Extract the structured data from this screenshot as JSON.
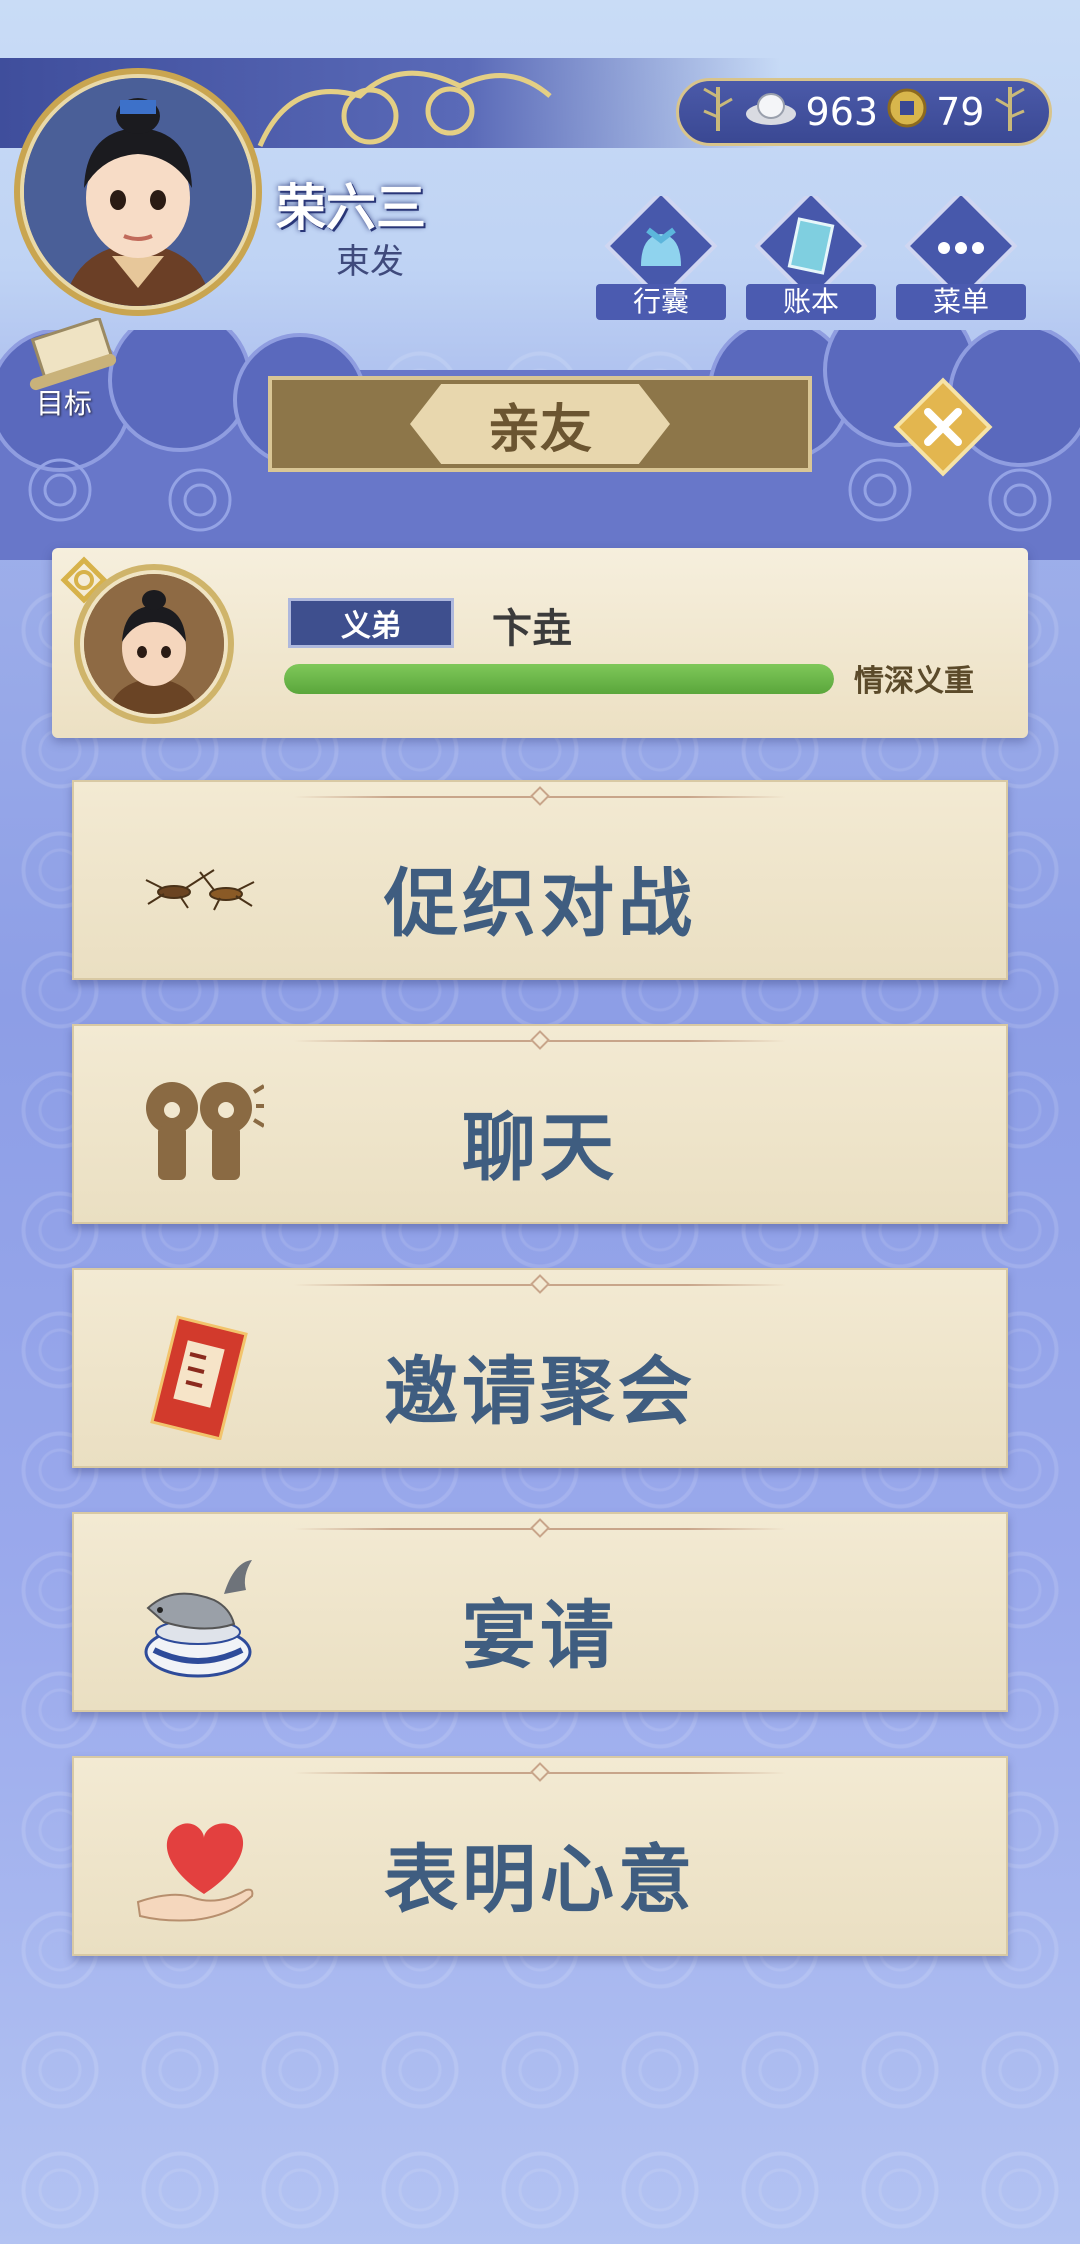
{
  "player": {
    "name": "荣六三",
    "title": "束发"
  },
  "currency": {
    "silver": "963",
    "coins": "79"
  },
  "top_buttons": [
    {
      "label": "行囊",
      "icon": "bag-icon"
    },
    {
      "label": "账本",
      "icon": "ledger-icon"
    },
    {
      "label": "菜单",
      "icon": "menu-icon"
    }
  ],
  "goal": {
    "label": "目标"
  },
  "header": {
    "title": "亲友"
  },
  "friend": {
    "relation": "义弟",
    "name": "卞垚",
    "affection_label": "情深义重",
    "affection_level": 1.0
  },
  "actions": [
    {
      "label": "促织对战",
      "icon": "cricket-icon"
    },
    {
      "label": "聊天",
      "icon": "chat-icon"
    },
    {
      "label": "邀请聚会",
      "icon": "invitation-icon"
    },
    {
      "label": "宴请",
      "icon": "banquet-fish-icon"
    },
    {
      "label": "表明心意",
      "icon": "heart-hand-icon"
    }
  ],
  "colors": {
    "accent": "#3f5d80",
    "banner": "#4b5aa9",
    "gold": "#d8c48b",
    "bar_fill": "#6db84a"
  }
}
